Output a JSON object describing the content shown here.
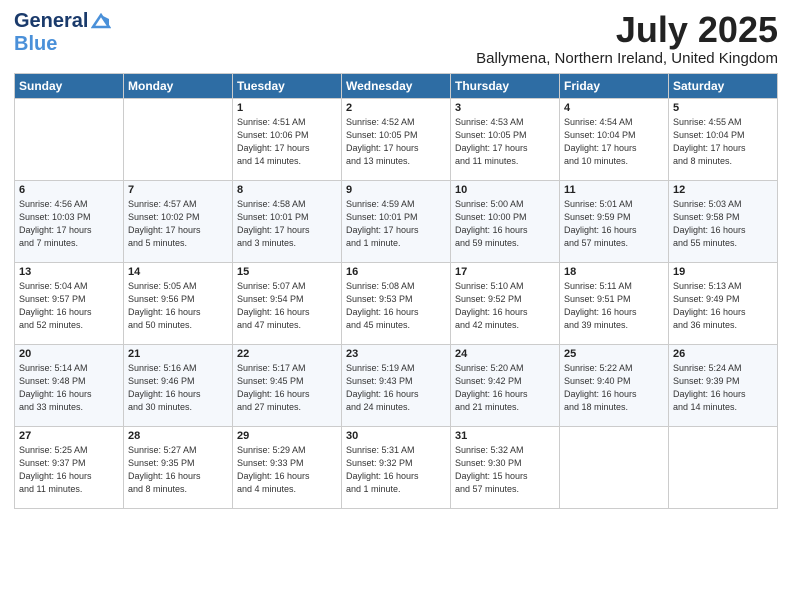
{
  "header": {
    "logo_general": "General",
    "logo_blue": "Blue",
    "main_title": "July 2025",
    "subtitle": "Ballymena, Northern Ireland, United Kingdom"
  },
  "days_of_week": [
    "Sunday",
    "Monday",
    "Tuesday",
    "Wednesday",
    "Thursday",
    "Friday",
    "Saturday"
  ],
  "weeks": [
    [
      {
        "day": "",
        "info": ""
      },
      {
        "day": "",
        "info": ""
      },
      {
        "day": "1",
        "info": "Sunrise: 4:51 AM\nSunset: 10:06 PM\nDaylight: 17 hours\nand 14 minutes."
      },
      {
        "day": "2",
        "info": "Sunrise: 4:52 AM\nSunset: 10:05 PM\nDaylight: 17 hours\nand 13 minutes."
      },
      {
        "day": "3",
        "info": "Sunrise: 4:53 AM\nSunset: 10:05 PM\nDaylight: 17 hours\nand 11 minutes."
      },
      {
        "day": "4",
        "info": "Sunrise: 4:54 AM\nSunset: 10:04 PM\nDaylight: 17 hours\nand 10 minutes."
      },
      {
        "day": "5",
        "info": "Sunrise: 4:55 AM\nSunset: 10:04 PM\nDaylight: 17 hours\nand 8 minutes."
      }
    ],
    [
      {
        "day": "6",
        "info": "Sunrise: 4:56 AM\nSunset: 10:03 PM\nDaylight: 17 hours\nand 7 minutes."
      },
      {
        "day": "7",
        "info": "Sunrise: 4:57 AM\nSunset: 10:02 PM\nDaylight: 17 hours\nand 5 minutes."
      },
      {
        "day": "8",
        "info": "Sunrise: 4:58 AM\nSunset: 10:01 PM\nDaylight: 17 hours\nand 3 minutes."
      },
      {
        "day": "9",
        "info": "Sunrise: 4:59 AM\nSunset: 10:01 PM\nDaylight: 17 hours\nand 1 minute."
      },
      {
        "day": "10",
        "info": "Sunrise: 5:00 AM\nSunset: 10:00 PM\nDaylight: 16 hours\nand 59 minutes."
      },
      {
        "day": "11",
        "info": "Sunrise: 5:01 AM\nSunset: 9:59 PM\nDaylight: 16 hours\nand 57 minutes."
      },
      {
        "day": "12",
        "info": "Sunrise: 5:03 AM\nSunset: 9:58 PM\nDaylight: 16 hours\nand 55 minutes."
      }
    ],
    [
      {
        "day": "13",
        "info": "Sunrise: 5:04 AM\nSunset: 9:57 PM\nDaylight: 16 hours\nand 52 minutes."
      },
      {
        "day": "14",
        "info": "Sunrise: 5:05 AM\nSunset: 9:56 PM\nDaylight: 16 hours\nand 50 minutes."
      },
      {
        "day": "15",
        "info": "Sunrise: 5:07 AM\nSunset: 9:54 PM\nDaylight: 16 hours\nand 47 minutes."
      },
      {
        "day": "16",
        "info": "Sunrise: 5:08 AM\nSunset: 9:53 PM\nDaylight: 16 hours\nand 45 minutes."
      },
      {
        "day": "17",
        "info": "Sunrise: 5:10 AM\nSunset: 9:52 PM\nDaylight: 16 hours\nand 42 minutes."
      },
      {
        "day": "18",
        "info": "Sunrise: 5:11 AM\nSunset: 9:51 PM\nDaylight: 16 hours\nand 39 minutes."
      },
      {
        "day": "19",
        "info": "Sunrise: 5:13 AM\nSunset: 9:49 PM\nDaylight: 16 hours\nand 36 minutes."
      }
    ],
    [
      {
        "day": "20",
        "info": "Sunrise: 5:14 AM\nSunset: 9:48 PM\nDaylight: 16 hours\nand 33 minutes."
      },
      {
        "day": "21",
        "info": "Sunrise: 5:16 AM\nSunset: 9:46 PM\nDaylight: 16 hours\nand 30 minutes."
      },
      {
        "day": "22",
        "info": "Sunrise: 5:17 AM\nSunset: 9:45 PM\nDaylight: 16 hours\nand 27 minutes."
      },
      {
        "day": "23",
        "info": "Sunrise: 5:19 AM\nSunset: 9:43 PM\nDaylight: 16 hours\nand 24 minutes."
      },
      {
        "day": "24",
        "info": "Sunrise: 5:20 AM\nSunset: 9:42 PM\nDaylight: 16 hours\nand 21 minutes."
      },
      {
        "day": "25",
        "info": "Sunrise: 5:22 AM\nSunset: 9:40 PM\nDaylight: 16 hours\nand 18 minutes."
      },
      {
        "day": "26",
        "info": "Sunrise: 5:24 AM\nSunset: 9:39 PM\nDaylight: 16 hours\nand 14 minutes."
      }
    ],
    [
      {
        "day": "27",
        "info": "Sunrise: 5:25 AM\nSunset: 9:37 PM\nDaylight: 16 hours\nand 11 minutes."
      },
      {
        "day": "28",
        "info": "Sunrise: 5:27 AM\nSunset: 9:35 PM\nDaylight: 16 hours\nand 8 minutes."
      },
      {
        "day": "29",
        "info": "Sunrise: 5:29 AM\nSunset: 9:33 PM\nDaylight: 16 hours\nand 4 minutes."
      },
      {
        "day": "30",
        "info": "Sunrise: 5:31 AM\nSunset: 9:32 PM\nDaylight: 16 hours\nand 1 minute."
      },
      {
        "day": "31",
        "info": "Sunrise: 5:32 AM\nSunset: 9:30 PM\nDaylight: 15 hours\nand 57 minutes."
      },
      {
        "day": "",
        "info": ""
      },
      {
        "day": "",
        "info": ""
      }
    ]
  ]
}
